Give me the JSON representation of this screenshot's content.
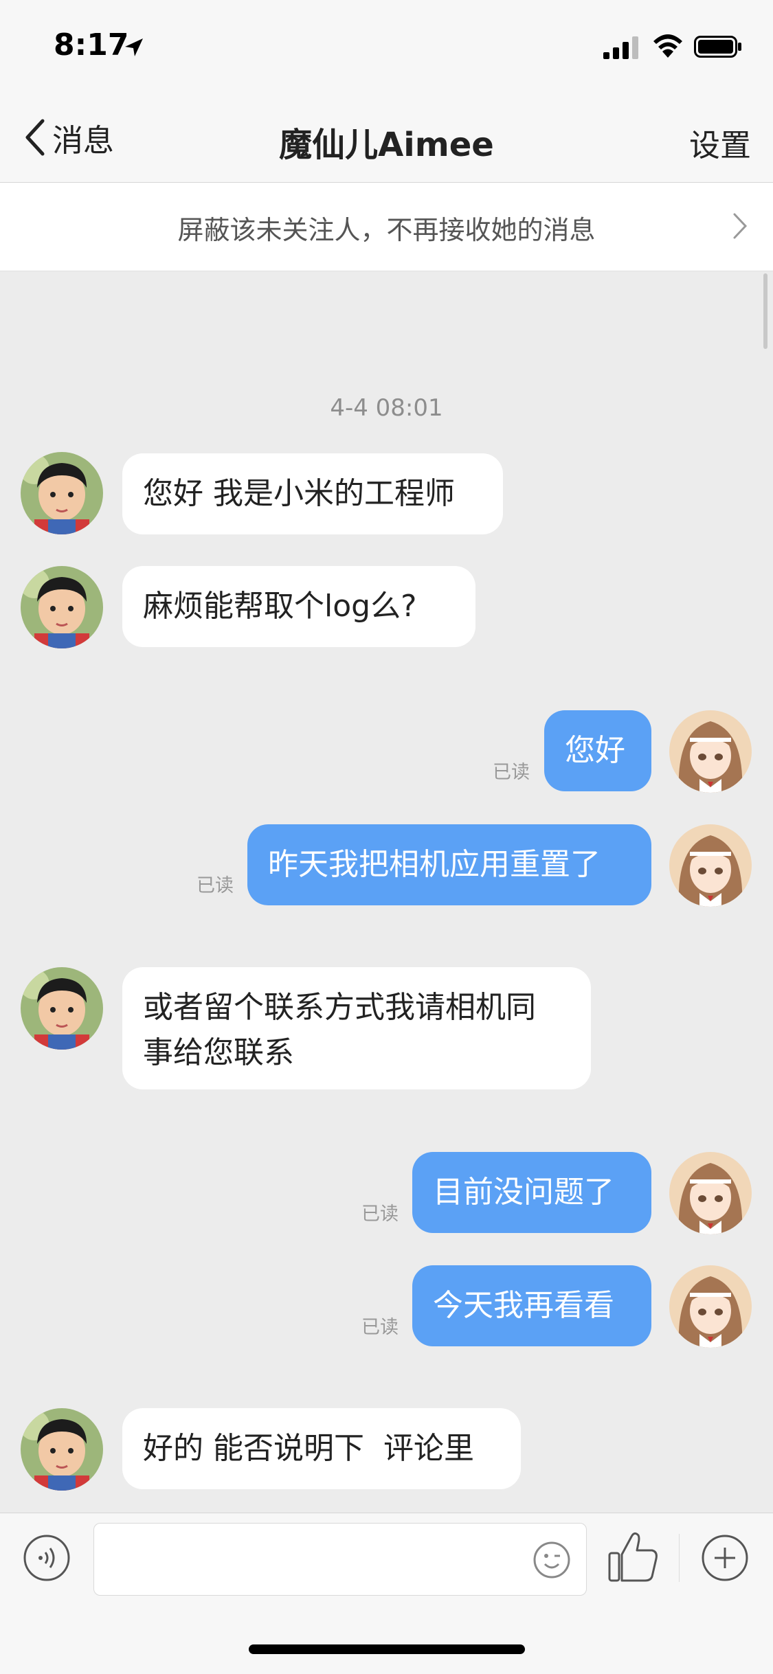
{
  "status_bar": {
    "time": "8:17"
  },
  "nav": {
    "back_label": "消息",
    "title": "魔仙儿Aimee",
    "settings_label": "设置"
  },
  "banner": {
    "text": "屏蔽该未关注人，不再接收她的消息"
  },
  "conversation": {
    "timestamp": "4-4 08:01",
    "read_label": "已读",
    "messages": [
      {
        "from": "them",
        "text": "您好 我是小米的工程师"
      },
      {
        "from": "them",
        "text": "麻烦能帮取个log么?"
      },
      {
        "from": "me",
        "text": "您好"
      },
      {
        "from": "me",
        "text": "昨天我把相机应用重置了"
      },
      {
        "from": "them",
        "text": "或者留个联系方式我请相机同\n事给您联系"
      },
      {
        "from": "me",
        "text": "目前没问题了"
      },
      {
        "from": "me",
        "text": "今天我再看看"
      },
      {
        "from": "them",
        "text": "好的 能否说明下  评论里"
      }
    ]
  },
  "input": {
    "placeholder": ""
  },
  "colors": {
    "outgoing_bubble": "#5ba1f5",
    "incoming_bubble": "#ffffff",
    "background": "#ececec"
  }
}
